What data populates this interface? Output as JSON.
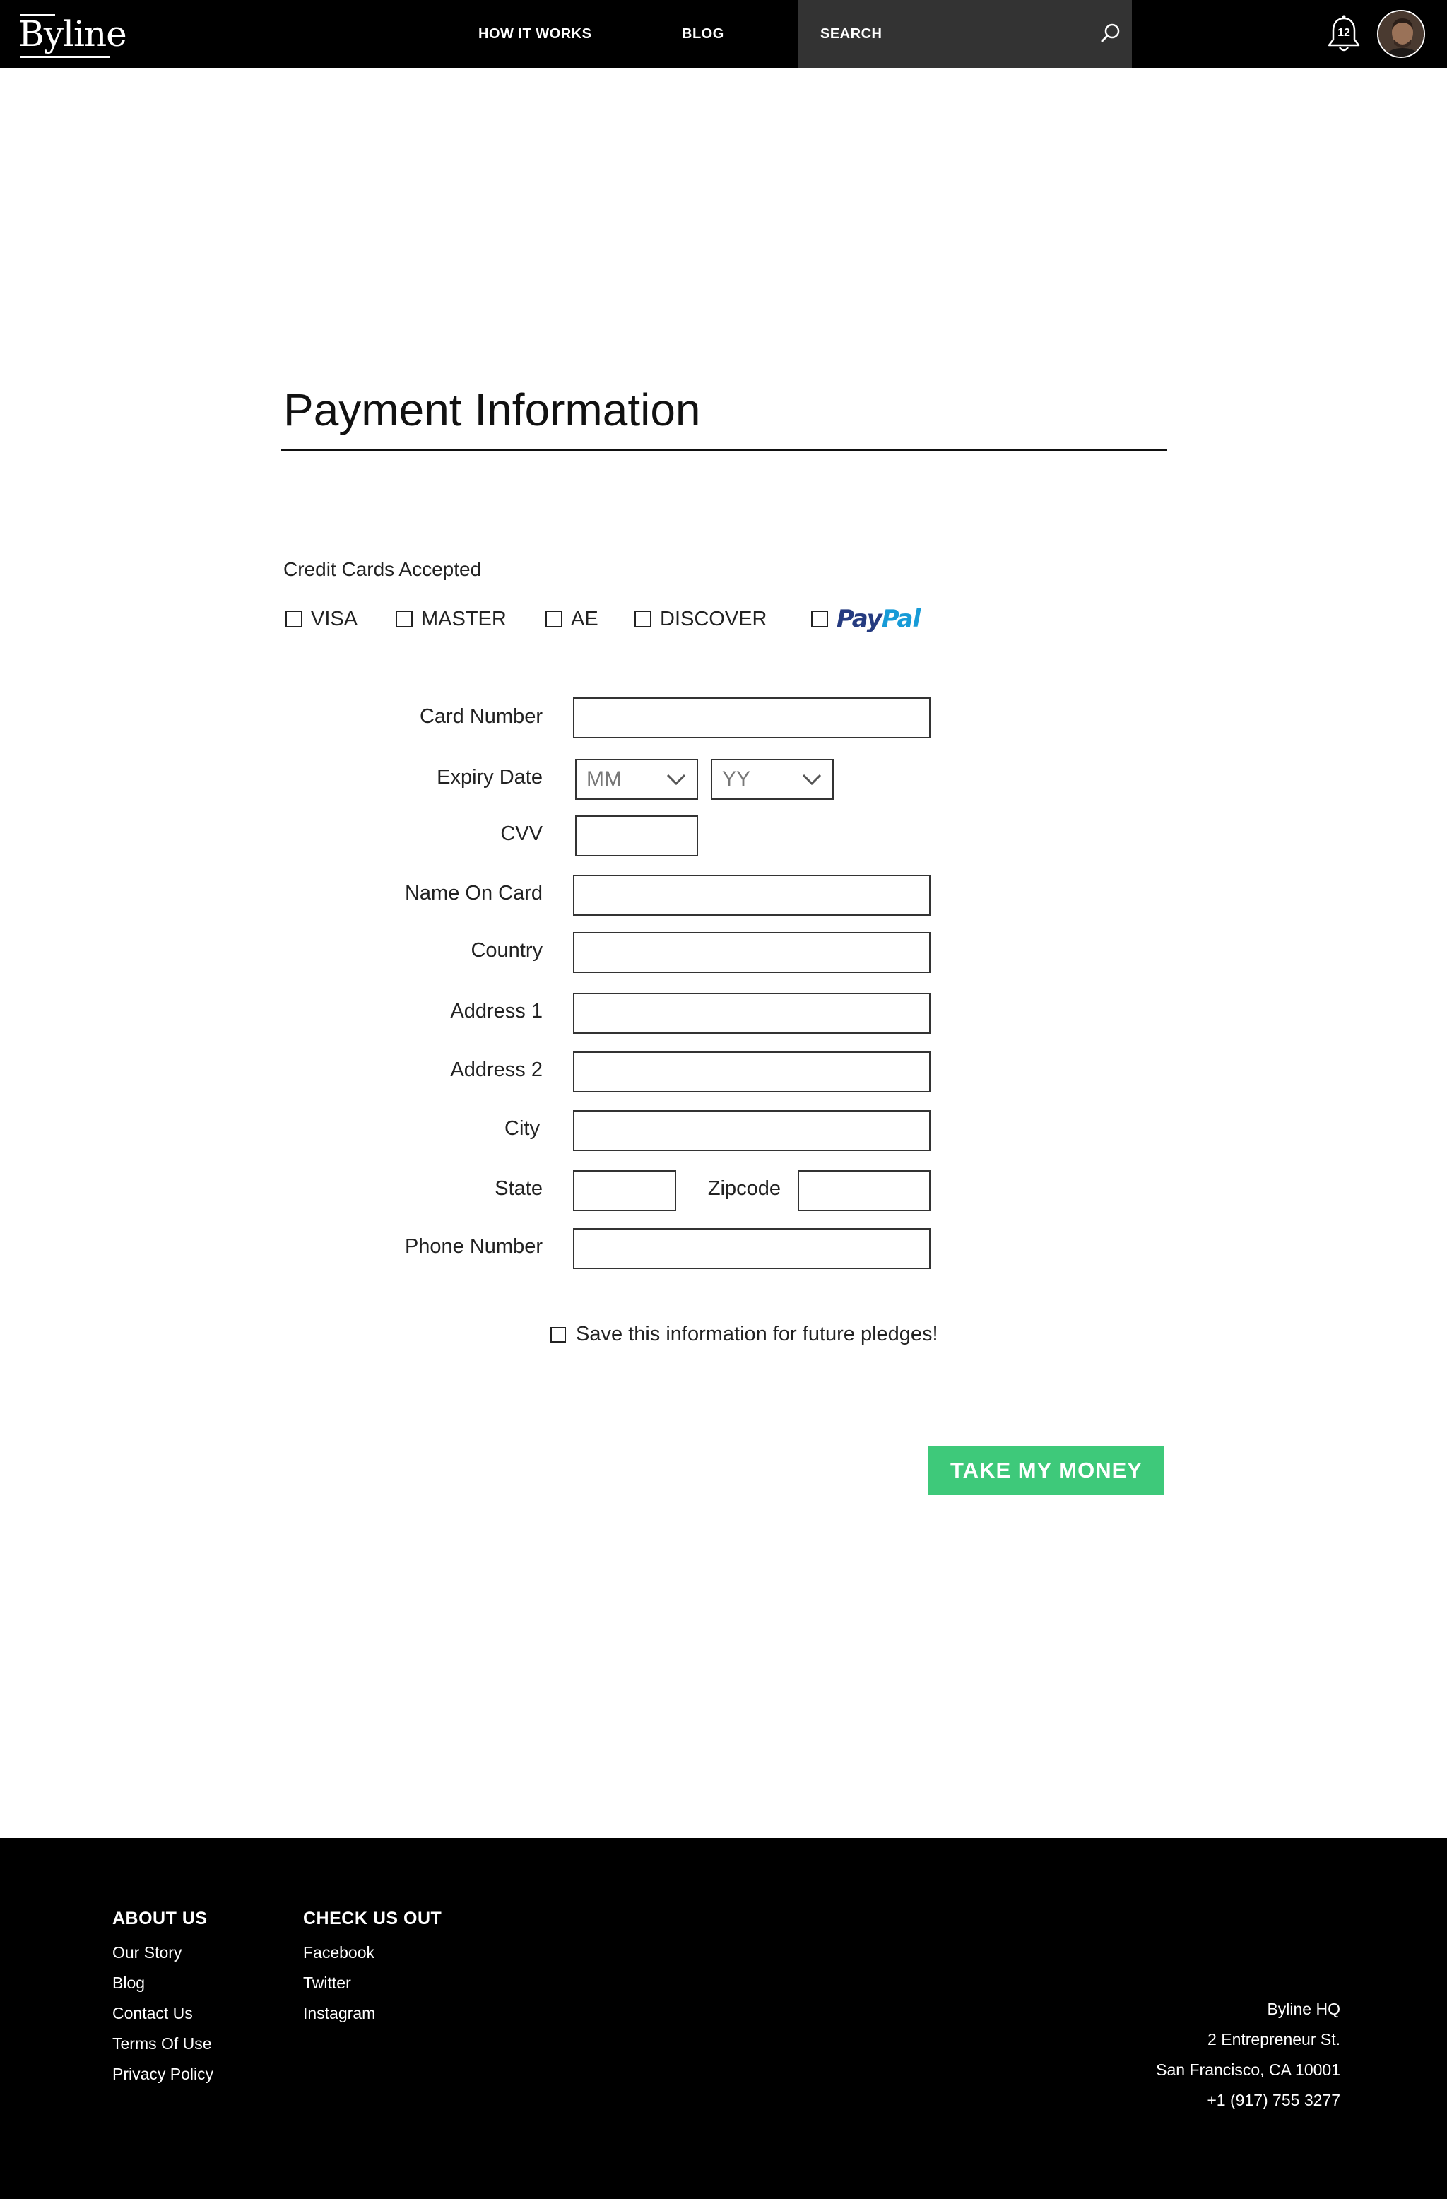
{
  "header": {
    "logo": "Byline",
    "nav": [
      {
        "label": "HOW IT WORKS"
      },
      {
        "label": "BLOG"
      }
    ],
    "search_placeholder": "SEARCH",
    "notification_count": "12"
  },
  "main": {
    "title": "Payment Information",
    "cards_label": "Credit Cards Accepted",
    "card_options": [
      "VISA",
      "MASTER",
      "AE",
      "DISCOVER"
    ],
    "paypal": {
      "pay": "Pay",
      "pal": "Pal"
    },
    "fields": {
      "card_number": "Card Number",
      "expiry_date": "Expiry Date",
      "cvv": "CVV",
      "name_on_card": "Name On Card",
      "country": "Country",
      "address1": "Address 1",
      "address2": "Address 2",
      "city": "City",
      "state": "State",
      "zipcode": "Zipcode",
      "phone": "Phone Number"
    },
    "expiry_month": "MM",
    "expiry_year": "YY",
    "save_label": "Save this information for future pledges!",
    "submit_label": "TAKE MY MONEY"
  },
  "footer": {
    "about": {
      "heading": "ABOUT US",
      "links": [
        "Our Story",
        "Blog",
        "Contact Us",
        "Terms Of Use",
        "Privacy Policy"
      ]
    },
    "check": {
      "heading": "CHECK US OUT",
      "links": [
        "Facebook",
        "Twitter",
        "Instagram"
      ]
    },
    "hq": [
      "Byline HQ",
      "2 Entrepreneur St.",
      "San Francisco, CA 10001",
      "+1 (917) 755 3277"
    ]
  },
  "colors": {
    "header_bg": "#000000",
    "search_bg": "#333333",
    "cta_green": "#3ec97a",
    "paypal_dark": "#253b80",
    "paypal_light": "#179bd7"
  }
}
